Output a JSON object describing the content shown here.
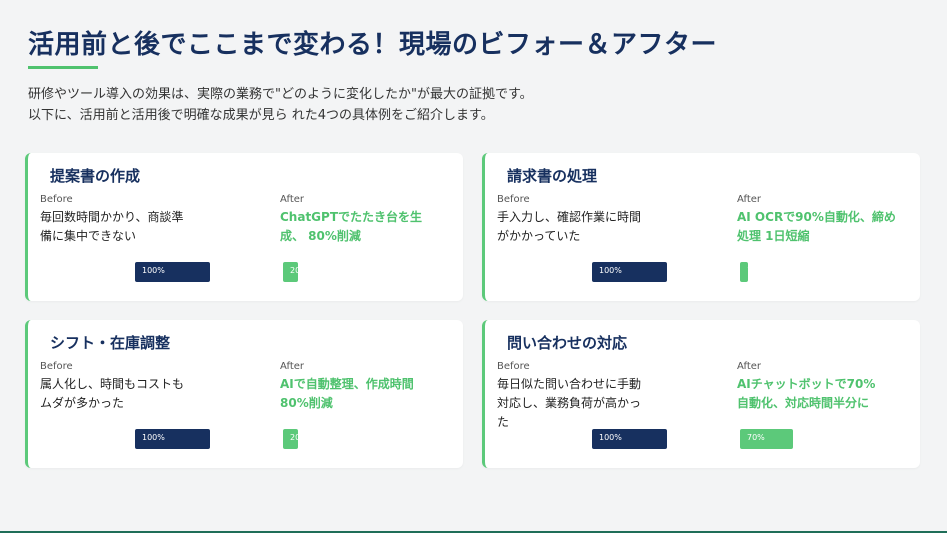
{
  "title": "活用前と後でここまで変わる！現場のビフォー＆アフター",
  "intro": [
    "研修やツール導入の効果は、実際の業務で\"どのように変化したか\"が最大の証拠です。",
    "以下に、活用前と活用後で明確な成果が見ら れた4つの具体例をご紹介します。"
  ],
  "cards": [
    {
      "title": "提案書の作成",
      "before_label": "Before",
      "before_lines": [
        "毎回数時間かかり、商談準",
        "備に集中できない"
      ],
      "after_label": "After",
      "after_lines": [
        "ChatGPTでたたき台を生",
        "成、 80%削減"
      ],
      "before_bar": "100%",
      "after_bar": "20",
      "after_value": 0.2
    },
    {
      "title": "請求書の処理",
      "before_label": "Before",
      "before_lines": [
        "手入力し、確認作業に時間",
        "がかかっていた"
      ],
      "after_label": "After",
      "after_lines": [
        "AI OCRで90%自動化、締め",
        "処理 1日短縮"
      ],
      "before_bar": "100%",
      "after_bar": "1",
      "after_value": 0.1
    },
    {
      "title": "シフト・在庫調整",
      "before_label": "Before",
      "before_lines": [
        "属人化し、時間もコストも",
        "ムダが多かった"
      ],
      "after_label": "After",
      "after_lines": [
        "AIで自動整理、作成時間",
        "80%削減"
      ],
      "before_bar": "100%",
      "after_bar": "20",
      "after_value": 0.2
    },
    {
      "title": "問い合わせの対応",
      "before_label": "Before",
      "before_lines": [
        "毎日似た問い合わせに手動",
        "対応し、業務負荷が高かっ",
        "た"
      ],
      "after_label": "After",
      "after_lines": [
        "AIチャットボットで70%",
        "自動化、対応時間半分に"
      ],
      "before_bar": "100%",
      "after_bar": "70%",
      "after_value": 0.7
    }
  ]
}
